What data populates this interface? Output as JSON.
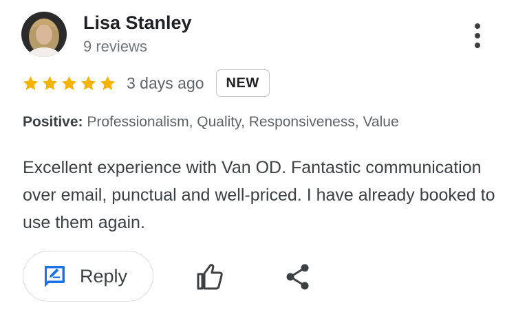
{
  "reviewer": {
    "name": "Lisa Stanley",
    "review_count": "9 reviews",
    "avatar": "reviewer-photo"
  },
  "menu": {
    "icon": "more-vert-icon"
  },
  "rating": {
    "stars": 5,
    "max_stars": 5,
    "star_color": "#f4b400",
    "date": "3 days ago",
    "badge": "NEW"
  },
  "positive": {
    "label": "Positive:",
    "values": "Professionalism, Quality, Responsiveness, Value"
  },
  "review": {
    "text": "Excellent experience with Van OD. Fantastic communication over email, punctual and well-priced. I have already booked to use them again."
  },
  "actions": {
    "reply_label": "Reply",
    "reply_icon": "rate-review-icon",
    "reply_icon_color": "#1a73e8",
    "like_icon": "thumb-up-icon",
    "share_icon": "share-icon"
  }
}
